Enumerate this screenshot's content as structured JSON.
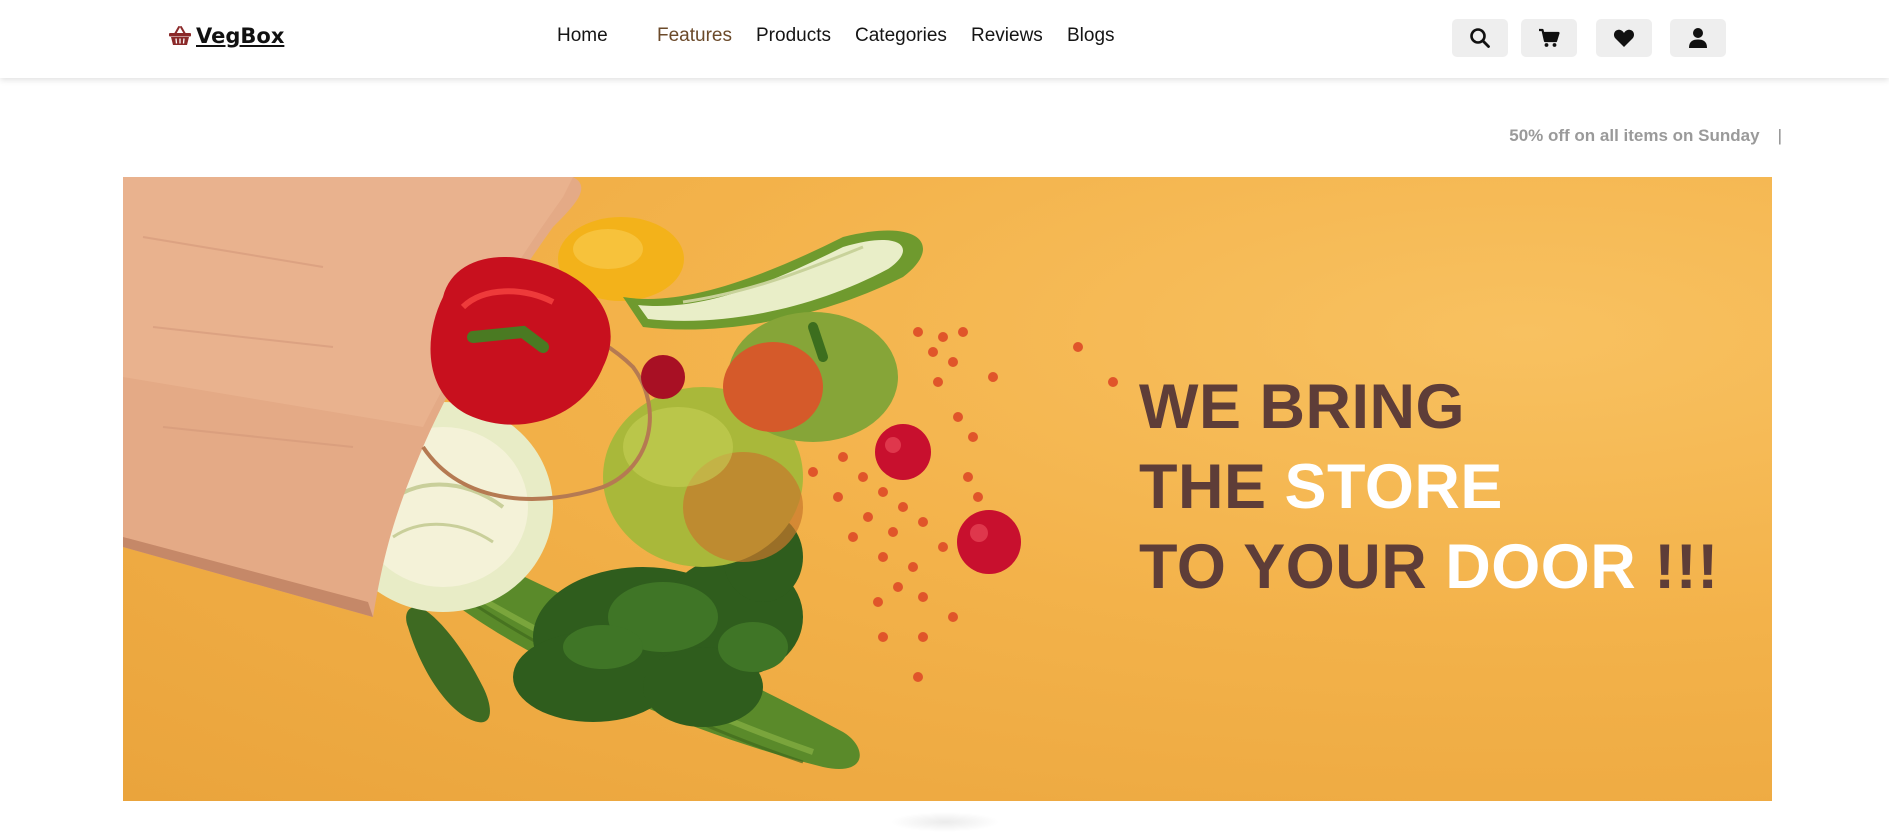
{
  "brand": {
    "name": "VegBox",
    "icon": "basket-icon"
  },
  "nav": {
    "items": [
      {
        "label": "Home",
        "active": false
      },
      {
        "label": "Features",
        "active": true
      },
      {
        "label": "Products",
        "active": false
      },
      {
        "label": "Categories",
        "active": false
      },
      {
        "label": "Reviews",
        "active": false
      },
      {
        "label": "Blogs",
        "active": false
      }
    ]
  },
  "actions": {
    "search_icon": "search-icon",
    "cart_icon": "cart-icon",
    "wishlist_icon": "heart-icon",
    "account_icon": "user-icon"
  },
  "promo": {
    "text": "50% off on all items on Sunday",
    "separator": "|"
  },
  "hero": {
    "line1": "WE BRING",
    "line2_a": "THE ",
    "line2_b": "STORE",
    "line3_a": "TO YOUR ",
    "line3_b": "DOOR",
    "line3_c": " !!!"
  },
  "colors": {
    "hero_bg": "#f3b24a",
    "hero_text": "#5e3d38",
    "hero_highlight": "#ffffff",
    "active_nav": "#6b4a2a",
    "brand_icon": "#8b2a2a"
  }
}
